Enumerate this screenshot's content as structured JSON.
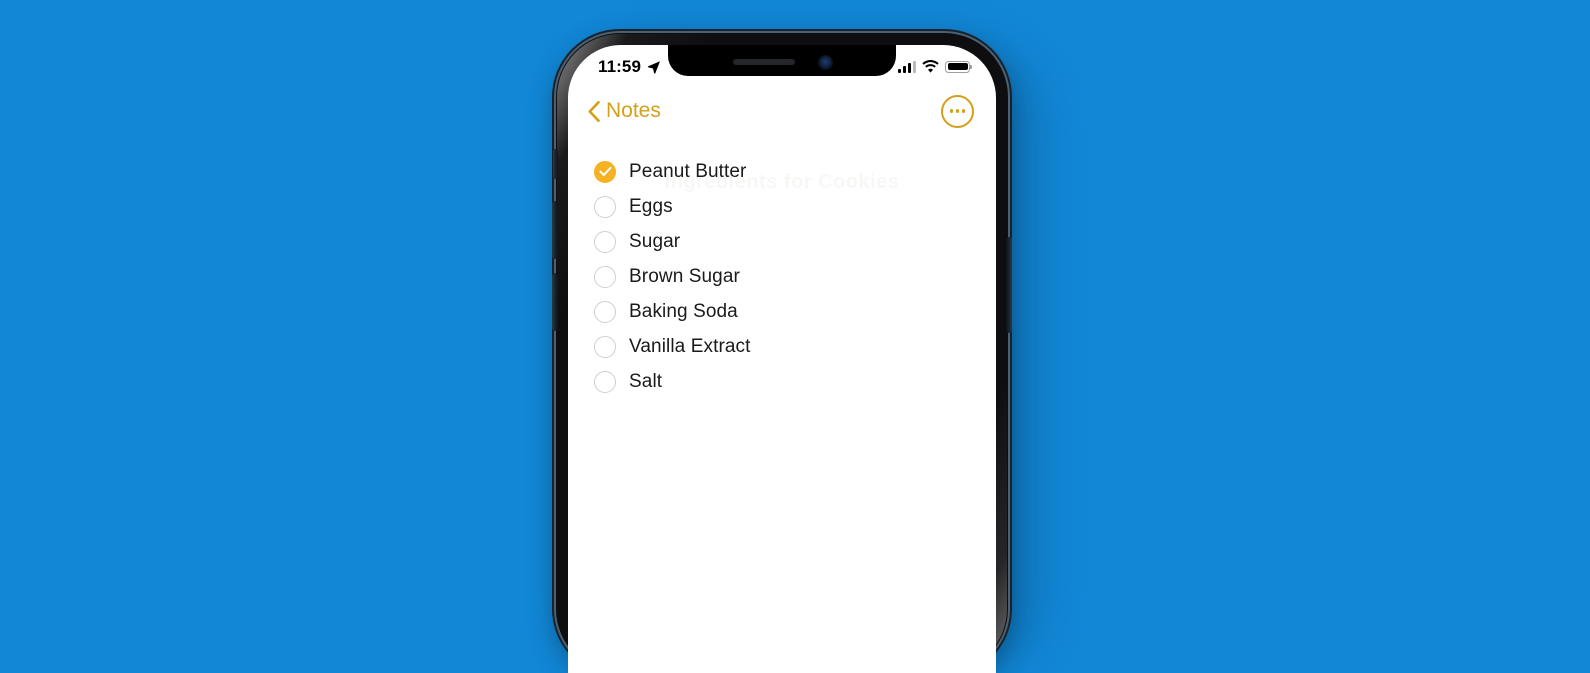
{
  "background": {
    "color": "#1287D6"
  },
  "device": {
    "name": "iphone-12",
    "frame_color": "#0E0E10",
    "buttons": {
      "mute_switch": "mute-switch",
      "volume_up": "volume-up",
      "volume_down": "volume-down",
      "power": "power-button"
    }
  },
  "status_bar": {
    "time": "11:59",
    "location_icon": "location-arrow-icon",
    "cellular_icon": "cellular-signal-icon",
    "cellular_bars_filled": 3,
    "cellular_bars_total": 4,
    "wifi_icon": "wifi-icon",
    "battery_icon": "battery-icon",
    "battery_level": 100
  },
  "nav_bar": {
    "back_label": "Notes",
    "back_icon": "chevron-left-icon",
    "more_icon": "more-options-icon",
    "accent_color": "#D4A017"
  },
  "note": {
    "ghost_title": "Ingredients for Cookies",
    "checked_color": "#F5B223",
    "unchecked_border_color": "#CFCFD2",
    "text_color": "#1A1A1A",
    "checklist": [
      {
        "label": "Peanut Butter",
        "checked": true
      },
      {
        "label": "Eggs",
        "checked": false
      },
      {
        "label": "Sugar",
        "checked": false
      },
      {
        "label": "Brown Sugar",
        "checked": false
      },
      {
        "label": "Baking Soda",
        "checked": false
      },
      {
        "label": "Vanilla Extract",
        "checked": false
      },
      {
        "label": "Salt",
        "checked": false
      }
    ]
  }
}
